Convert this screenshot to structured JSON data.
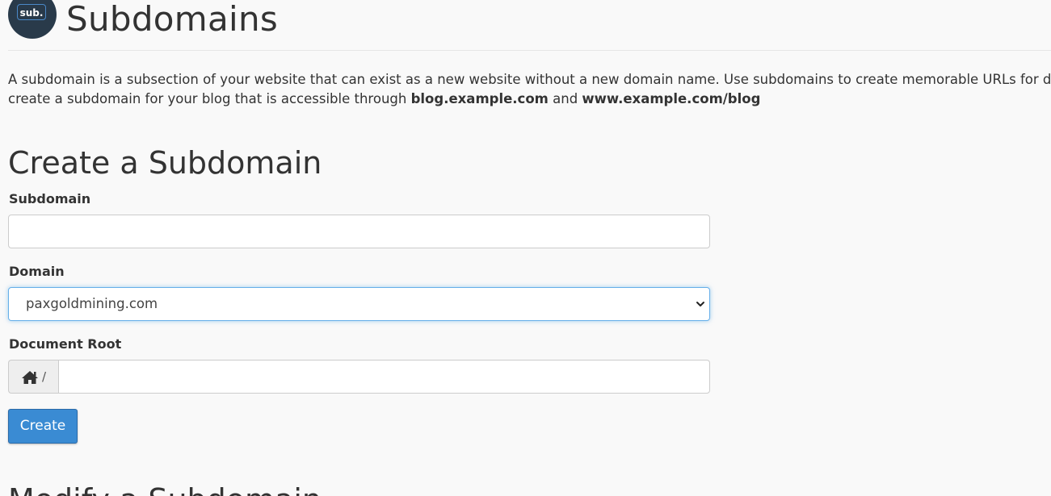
{
  "header": {
    "logo_text": "sub.",
    "title": "Subdomains"
  },
  "intro": {
    "text_before": "A subdomain is a subsection of your website that can exist as a new website without a new domain name. Use subdomains to create memorable URLs for diffe",
    "text_line2_start": "create a subdomain for your blog that is accessible through ",
    "example1": "blog.example.com",
    "connector": " and ",
    "example2": "www.example.com/blog"
  },
  "create_section": {
    "heading": "Create a Subdomain",
    "subdomain_label": "Subdomain",
    "subdomain_value": "",
    "domain_label": "Domain",
    "domain_selected": "paxgoldmining.com",
    "docroot_label": "Document Root",
    "docroot_prefix": "/",
    "docroot_value": "",
    "create_button": "Create"
  },
  "modify_section": {
    "heading": "Modify a Subdomain"
  },
  "colors": {
    "background": "#f9f9f9",
    "text": "#333333",
    "logo_bg": "#293a4a",
    "logo_border": "#4a88c7",
    "button_bg": "#3a8bd3",
    "focus_border": "#66afe9",
    "addon_bg": "#eeeeee"
  },
  "icons": {
    "home": "home-icon",
    "select_arrow": "chevron-down-icon"
  }
}
